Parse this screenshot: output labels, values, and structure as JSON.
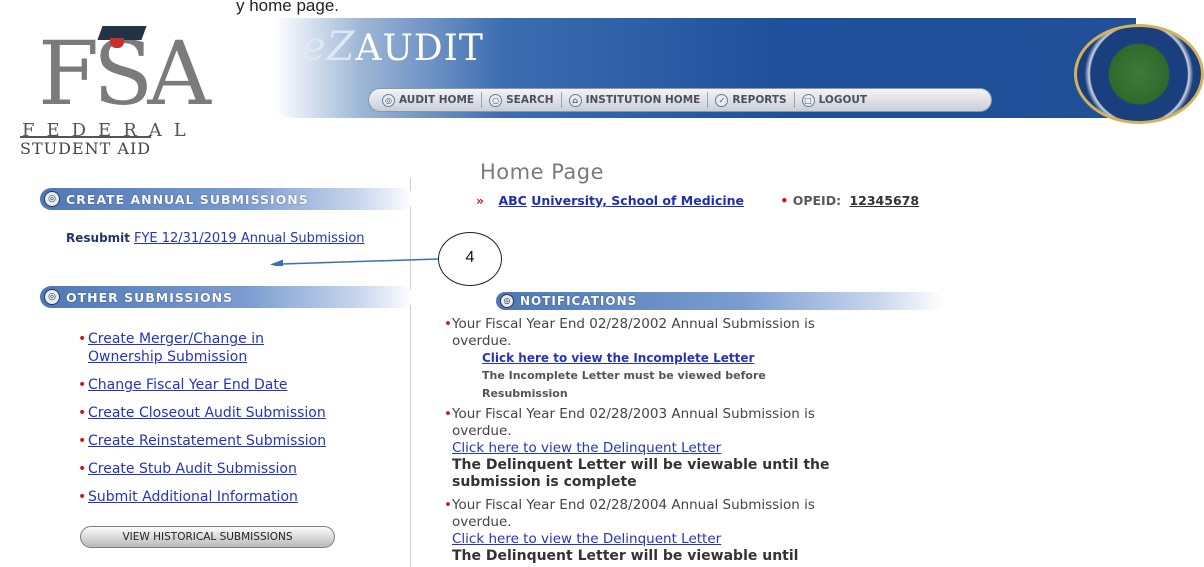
{
  "caption": "y home page.",
  "header": {
    "fsa_letters": "FSA",
    "fsa_federal": "FEDERAL",
    "fsa_student": "STUDENT AID",
    "app_title_prefix": "eZ",
    "app_title_rest": "AUDIT",
    "nav": [
      {
        "label": "AUDIT HOME",
        "icon": "home-swirl-icon"
      },
      {
        "label": "SEARCH",
        "icon": "search-icon"
      },
      {
        "label": "INSTITUTION HOME",
        "icon": "house-icon"
      },
      {
        "label": "REPORTS",
        "icon": "reports-icon"
      },
      {
        "label": "LOGOUT",
        "icon": "logout-icon"
      }
    ]
  },
  "left": {
    "create_title": "CREATE ANNUAL SUBMISSIONS",
    "resubmit_label": "Resubmit",
    "resubmit_link": "FYE 12/31/2019 Annual Submission",
    "other_title": "OTHER SUBMISSIONS",
    "other_items": [
      "Create Merger/Change in Ownership Submission",
      "Change Fiscal Year End Date",
      "Create Closeout Audit Submission",
      "Create Reinstatement Submission",
      "Create Stub Audit Submission",
      "Submit Additional Information"
    ],
    "history_button": "VIEW HISTORICAL SUBMISSIONS"
  },
  "annotation": {
    "label": "4"
  },
  "main": {
    "page_title": "Home Page",
    "chevron": "»",
    "institution_abbrev": "ABC",
    "institution_name": "University, School of Medicine",
    "opeid_label": "OPEID:",
    "opeid_value": "12345678",
    "notifications_title": "NOTIFICATIONS",
    "notifications": [
      {
        "text": "Your Fiscal Year End 02/28/2002 Annual Submission is overdue.",
        "link": "Click here to view the Incomplete Letter",
        "note": "The Incomplete Letter must be viewed before Resubmission"
      },
      {
        "text": "Your Fiscal Year End 02/28/2003 Annual Submission is overdue.",
        "link": "Click here to view the Delinquent Letter",
        "note": "The Delinquent Letter will be viewable until the submission is complete"
      },
      {
        "text": "Your Fiscal Year End 02/28/2004 Annual Submission is overdue.",
        "link": "Click here to view the Delinquent Letter",
        "note": "The Delinquent Letter will be viewable until"
      }
    ]
  },
  "colors": {
    "accent_blue": "#214f98",
    "link": "#2533bd",
    "bullet_red": "#d01616"
  }
}
